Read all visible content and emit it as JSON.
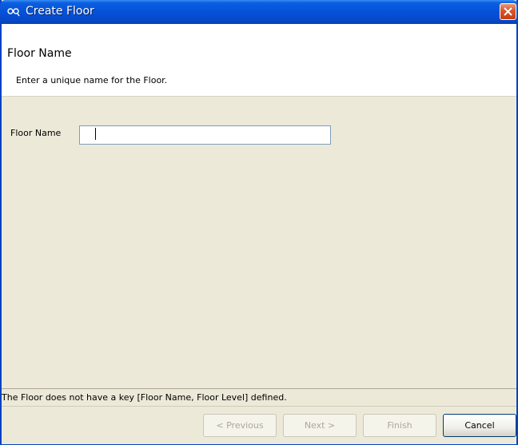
{
  "window": {
    "title": "Create Floor",
    "icon": "app-icon",
    "close_icon": "close-icon"
  },
  "header": {
    "title": "Floor Name",
    "description": "Enter a unique name for the Floor."
  },
  "form": {
    "floor_name_label": "Floor Name",
    "floor_name_value": ""
  },
  "status": {
    "message": "The Floor does not have a key [Floor Name, Floor Level] defined."
  },
  "buttons": {
    "previous": "< Previous",
    "next": "Next >",
    "finish": "Finish",
    "cancel": "Cancel"
  },
  "colors": {
    "titlebar": "#0551d8",
    "dialog_bg": "#ece9d8",
    "header_bg": "#ffffff",
    "close_button": "#d9592f"
  }
}
